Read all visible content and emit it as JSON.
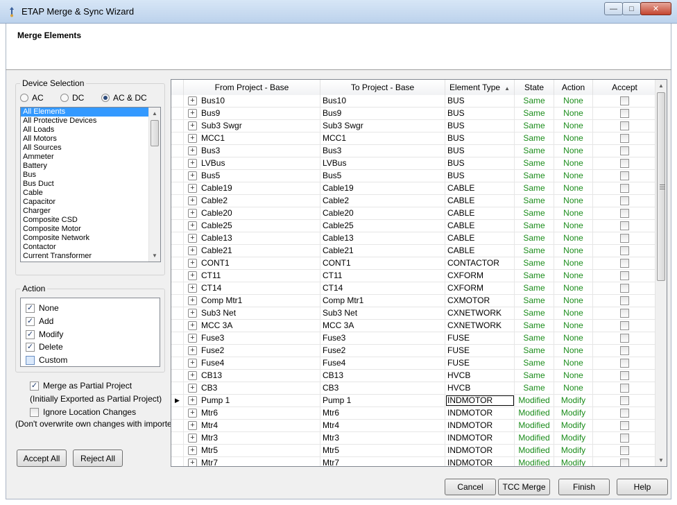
{
  "window": {
    "title": "ETAP Merge & Sync Wizard",
    "minimize_glyph": "—",
    "maximize_glyph": "□",
    "close_glyph": "✕"
  },
  "header": {
    "title": "Merge Elements"
  },
  "device_selection": {
    "label": "Device Selection",
    "radios": [
      {
        "label": "AC",
        "selected": false
      },
      {
        "label": "DC",
        "selected": false
      },
      {
        "label": "AC & DC",
        "selected": true
      }
    ],
    "list_items": [
      "All Elements",
      "All Protective Devices",
      "All Loads",
      "All Motors",
      "All Sources",
      "Ammeter",
      "Battery",
      "Bus",
      "Bus Duct",
      "Cable",
      "Capacitor",
      "Charger",
      "Composite CSD",
      "Composite Motor",
      "Composite Network",
      "Contactor",
      "Current Transformer"
    ],
    "selected_index": 0
  },
  "action_group": {
    "label": "Action",
    "items": [
      {
        "label": "None",
        "checked": true
      },
      {
        "label": "Add",
        "checked": true
      },
      {
        "label": "Modify",
        "checked": true
      },
      {
        "label": "Delete",
        "checked": true
      },
      {
        "label": "Custom",
        "checked": false
      }
    ]
  },
  "options": {
    "merge_partial_label": "Merge as Partial Project",
    "merge_partial_checked": true,
    "merge_partial_note": "(Initially Exported as Partial Project)",
    "ignore_location_label": "Ignore Location Changes",
    "ignore_location_checked": false,
    "ignore_location_note": "(Don't overwrite own changes with imported)"
  },
  "left_buttons": {
    "accept_all": "Accept All",
    "reject_all": "Reject All"
  },
  "grid": {
    "columns": {
      "from": "From Project - Base",
      "to": "To Project - Base",
      "type": "Element Type",
      "state": "State",
      "action": "Action",
      "accept": "Accept"
    },
    "sort_glyph": "▲",
    "current_row_glyph": "▶",
    "expand_glyph": "+",
    "rows": [
      {
        "from": "Bus10",
        "to": "Bus10",
        "type": "BUS",
        "state": "Same",
        "action": "None"
      },
      {
        "from": "Bus9",
        "to": "Bus9",
        "type": "BUS",
        "state": "Same",
        "action": "None"
      },
      {
        "from": "Sub3 Swgr",
        "to": "Sub3 Swgr",
        "type": "BUS",
        "state": "Same",
        "action": "None"
      },
      {
        "from": "MCC1",
        "to": "MCC1",
        "type": "BUS",
        "state": "Same",
        "action": "None"
      },
      {
        "from": "Bus3",
        "to": "Bus3",
        "type": "BUS",
        "state": "Same",
        "action": "None"
      },
      {
        "from": "LVBus",
        "to": "LVBus",
        "type": "BUS",
        "state": "Same",
        "action": "None"
      },
      {
        "from": "Bus5",
        "to": "Bus5",
        "type": "BUS",
        "state": "Same",
        "action": "None"
      },
      {
        "from": "Cable19",
        "to": "Cable19",
        "type": "CABLE",
        "state": "Same",
        "action": "None"
      },
      {
        "from": "Cable2",
        "to": "Cable2",
        "type": "CABLE",
        "state": "Same",
        "action": "None"
      },
      {
        "from": "Cable20",
        "to": "Cable20",
        "type": "CABLE",
        "state": "Same",
        "action": "None"
      },
      {
        "from": "Cable25",
        "to": "Cable25",
        "type": "CABLE",
        "state": "Same",
        "action": "None"
      },
      {
        "from": "Cable13",
        "to": "Cable13",
        "type": "CABLE",
        "state": "Same",
        "action": "None"
      },
      {
        "from": "Cable21",
        "to": "Cable21",
        "type": "CABLE",
        "state": "Same",
        "action": "None"
      },
      {
        "from": "CONT1",
        "to": "CONT1",
        "type": "CONTACTOR",
        "state": "Same",
        "action": "None"
      },
      {
        "from": "CT11",
        "to": "CT11",
        "type": "CXFORM",
        "state": "Same",
        "action": "None"
      },
      {
        "from": "CT14",
        "to": "CT14",
        "type": "CXFORM",
        "state": "Same",
        "action": "None"
      },
      {
        "from": "Comp Mtr1",
        "to": "Comp Mtr1",
        "type": "CXMOTOR",
        "state": "Same",
        "action": "None"
      },
      {
        "from": "Sub3 Net",
        "to": "Sub3 Net",
        "type": "CXNETWORK",
        "state": "Same",
        "action": "None"
      },
      {
        "from": "MCC 3A",
        "to": "MCC 3A",
        "type": "CXNETWORK",
        "state": "Same",
        "action": "None"
      },
      {
        "from": "Fuse3",
        "to": "Fuse3",
        "type": "FUSE",
        "state": "Same",
        "action": "None"
      },
      {
        "from": "Fuse2",
        "to": "Fuse2",
        "type": "FUSE",
        "state": "Same",
        "action": "None"
      },
      {
        "from": "Fuse4",
        "to": "Fuse4",
        "type": "FUSE",
        "state": "Same",
        "action": "None"
      },
      {
        "from": "CB13",
        "to": "CB13",
        "type": "HVCB",
        "state": "Same",
        "action": "None"
      },
      {
        "from": "CB3",
        "to": "CB3",
        "type": "HVCB",
        "state": "Same",
        "action": "None"
      },
      {
        "from": "Pump 1",
        "to": "Pump 1",
        "type": "INDMOTOR",
        "state": "Modified",
        "action": "Modify",
        "current": true
      },
      {
        "from": "Mtr6",
        "to": "Mtr6",
        "type": "INDMOTOR",
        "state": "Modified",
        "action": "Modify"
      },
      {
        "from": "Mtr4",
        "to": "Mtr4",
        "type": "INDMOTOR",
        "state": "Modified",
        "action": "Modify"
      },
      {
        "from": "Mtr3",
        "to": "Mtr3",
        "type": "INDMOTOR",
        "state": "Modified",
        "action": "Modify"
      },
      {
        "from": "Mtr5",
        "to": "Mtr5",
        "type": "INDMOTOR",
        "state": "Modified",
        "action": "Modify"
      },
      {
        "from": "Mtr7",
        "to": "Mtr7",
        "type": "INDMOTOR",
        "state": "Modified",
        "action": "Modify"
      }
    ]
  },
  "footer_buttons": {
    "cancel": "Cancel",
    "tcc_merge": "TCC Merge",
    "finish": "Finish",
    "help": "Help"
  },
  "colors": {
    "status_green": "#1a8c1a",
    "selection": "#3399ff"
  }
}
